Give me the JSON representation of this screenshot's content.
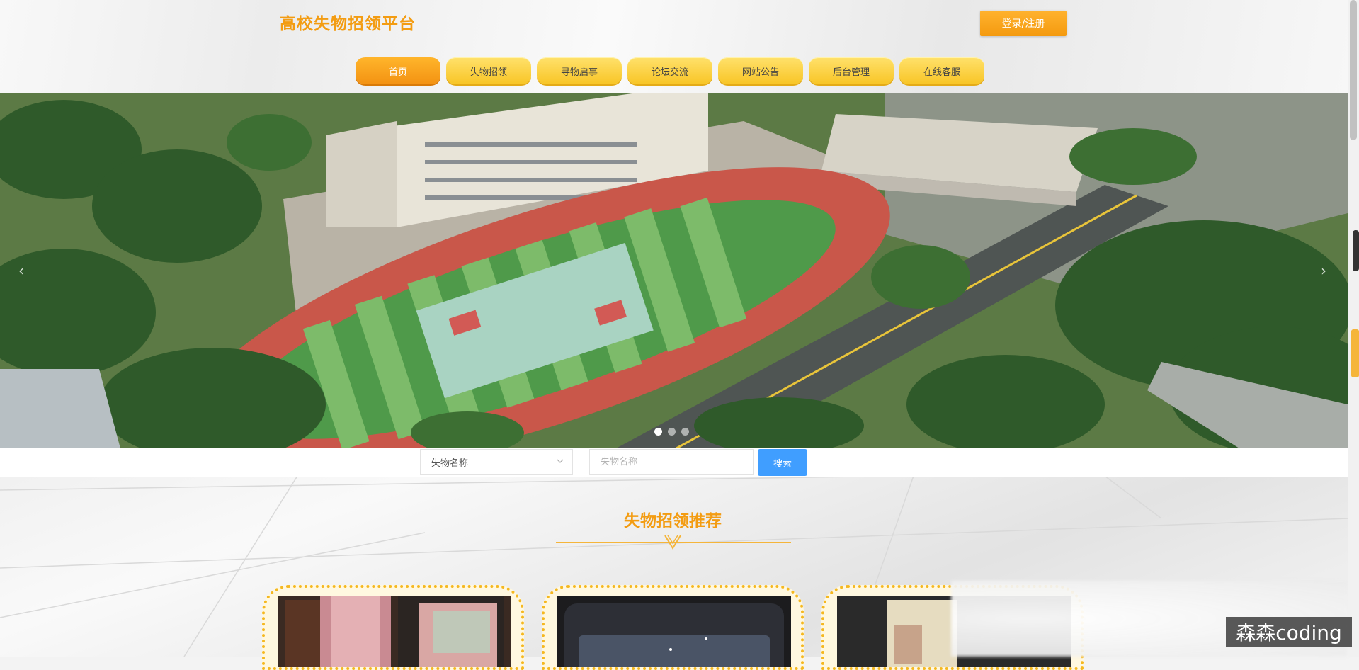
{
  "header": {
    "site_title": "高校失物招领平台",
    "login_label": "登录/注册"
  },
  "nav": {
    "items": [
      {
        "label": "首页",
        "active": true
      },
      {
        "label": "失物招领"
      },
      {
        "label": "寻物启事"
      },
      {
        "label": "论坛交流"
      },
      {
        "label": "网站公告"
      },
      {
        "label": "后台管理"
      },
      {
        "label": "在线客服"
      }
    ]
  },
  "banner": {
    "prev_icon": "chevron-left-icon",
    "next_icon": "chevron-right-icon",
    "slide_count": 3,
    "active_slide": 1
  },
  "search": {
    "select_value": "失物名称",
    "input_placeholder": "失物名称",
    "button_label": "搜索"
  },
  "section": {
    "title": "失物招领推荐"
  },
  "watermark": "森森coding",
  "colors": {
    "accent": "#f39c12",
    "nav_yellow": "#f8c526",
    "search_blue": "#409eff"
  }
}
